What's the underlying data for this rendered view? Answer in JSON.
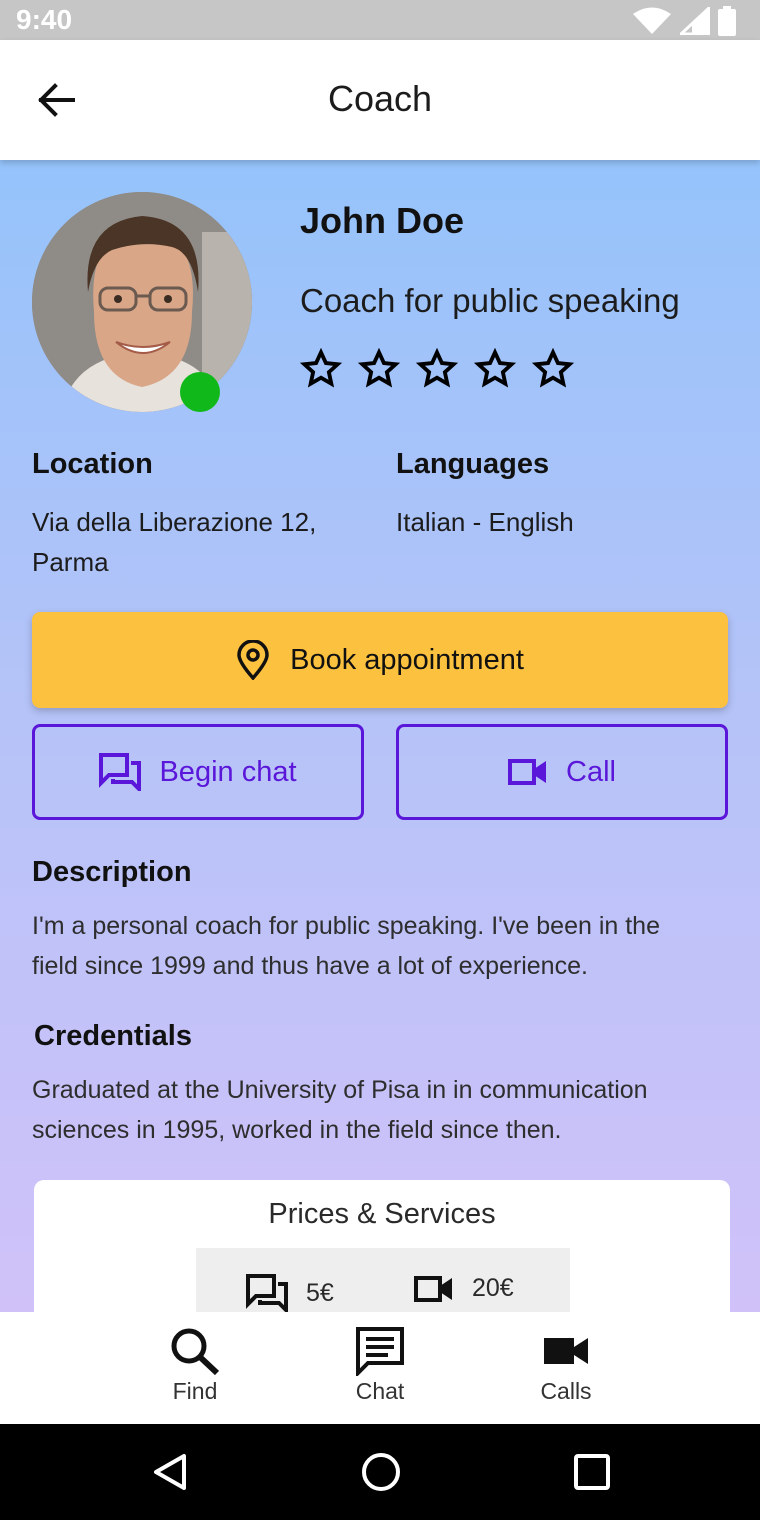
{
  "status_bar": {
    "time": "9:40"
  },
  "app_bar": {
    "title": "Coach"
  },
  "profile": {
    "name": "John Doe",
    "subtitle": "Coach for public speaking",
    "rating_max": 5,
    "rating_value": 0,
    "online_color": "#10b81a"
  },
  "info": {
    "location_label": "Location",
    "location_line1": "Via della Liberazione 12,",
    "location_line2": "Parma",
    "languages_label": "Languages",
    "languages_value": "Italian - English"
  },
  "actions": {
    "book_label": "Book appointment",
    "chat_label": "Begin chat",
    "call_label": "Call",
    "book_color": "#fcc23f",
    "accent_color": "#5a16d9"
  },
  "description": {
    "title": "Description",
    "line1": "I'm a personal coach for public speaking. I've been in the",
    "line2": "field since 1999 and thus have a lot of experience."
  },
  "credentials": {
    "title": "Credentials",
    "line1": "Graduated at the University of Pisa in in communication",
    "line2": "sciences in 1995, worked in the field since then."
  },
  "prices": {
    "title": "Prices & Services",
    "chat_price": "5€",
    "call_price": "20€"
  },
  "bottom_nav": {
    "items": [
      {
        "label": "Find",
        "icon": "search-icon"
      },
      {
        "label": "Chat",
        "icon": "chat-icon"
      },
      {
        "label": "Calls",
        "icon": "videocam-icon"
      }
    ]
  }
}
